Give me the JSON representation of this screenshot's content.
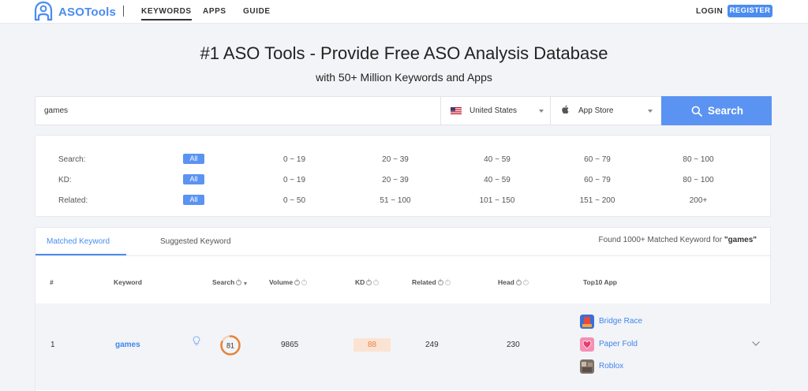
{
  "nav": {
    "logo_text": "ASOTools",
    "links": [
      "KEYWORDS",
      "APPS",
      "GUIDE"
    ],
    "login": "LOGIN",
    "register": "REGISTER"
  },
  "hero": {
    "title": "#1 ASO Tools - Provide Free ASO Analysis Database",
    "subtitle": "with 50+ Million Keywords and Apps"
  },
  "search": {
    "query": "games",
    "country": "United States",
    "store": "App Store",
    "button": "Search"
  },
  "filters": {
    "all_label": "All",
    "rows": [
      {
        "label": "Search:",
        "options": [
          "0 ~ 19",
          "20 ~ 39",
          "40 ~ 59",
          "60 ~ 79",
          "80 ~ 100"
        ]
      },
      {
        "label": "KD:",
        "options": [
          "0 ~ 19",
          "20 ~ 39",
          "40 ~ 59",
          "60 ~ 79",
          "80 ~ 100"
        ]
      },
      {
        "label": "Related:",
        "options": [
          "0 ~ 50",
          "51 ~ 100",
          "101 ~ 150",
          "151 ~ 200",
          "200+"
        ]
      }
    ]
  },
  "results": {
    "tabs": [
      "Matched Keyword",
      "Suggested Keyword"
    ],
    "found_prefix": "Found",
    "found_count": "1000+",
    "found_middle": "Matched Keyword for",
    "found_query": "\"games\"",
    "columns": [
      "#",
      "Keyword",
      "Search",
      "Volume",
      "KD",
      "Related",
      "Head",
      "Top10 App"
    ],
    "rows": [
      {
        "index": "1",
        "keyword": "games",
        "search_score": "81",
        "search_fraction": 0.81,
        "volume": "9865",
        "kd": "88",
        "related": "249",
        "head": "230",
        "apps": [
          "Bridge Race",
          "Paper Fold",
          "Roblox"
        ]
      }
    ]
  },
  "colors": {
    "accent": "#4a8cf0",
    "button": "#5b93f2",
    "search_ring": "#e6843b",
    "kd_badge_bg": "#fbe3d4"
  },
  "icons": [
    "logo-icon",
    "us-flag-icon",
    "apple-icon",
    "search-icon",
    "info-icon",
    "sort-arrow-icon",
    "lightbulb-icon",
    "chevron-down-icon"
  ]
}
